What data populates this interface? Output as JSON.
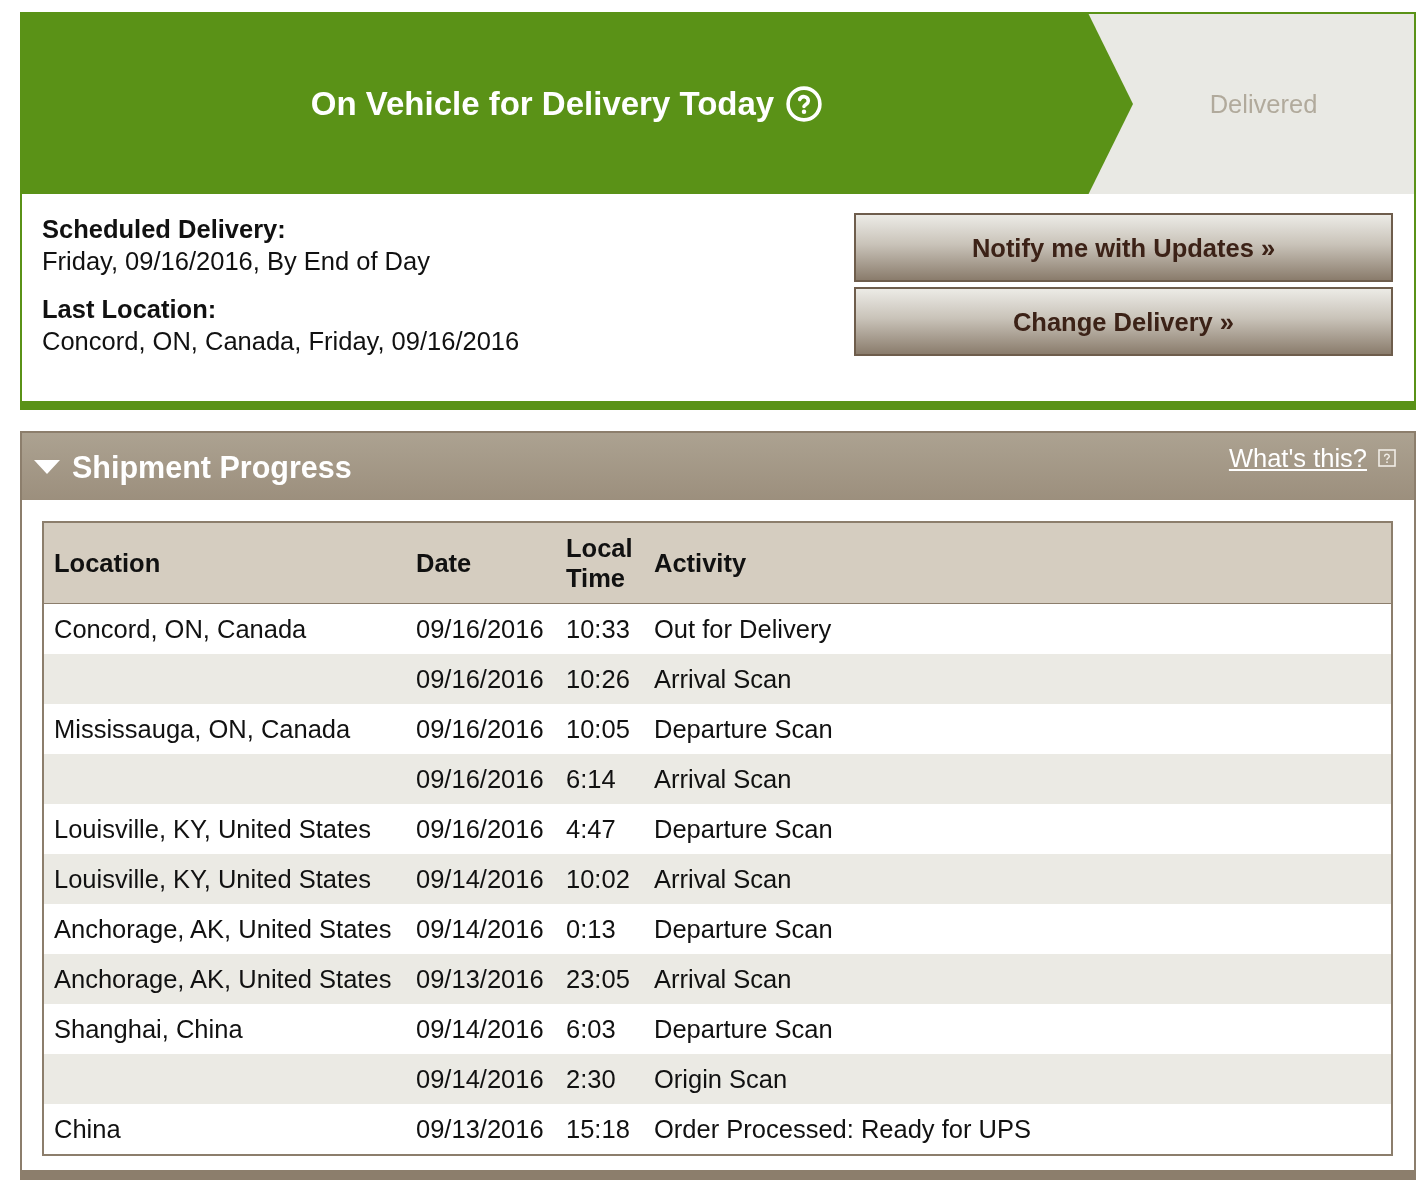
{
  "status": {
    "steps": [
      {
        "label": "On Vehicle for Delivery Today",
        "current": true,
        "help": true
      },
      {
        "label": "Delivered",
        "current": false
      }
    ]
  },
  "details": [
    {
      "label": "Scheduled Delivery:",
      "value": "Friday, 09/16/2016, By End of Day"
    },
    {
      "label": "Last Location:",
      "value": "Concord, ON, Canada, Friday, 09/16/2016"
    }
  ],
  "actions": [
    "Notify me with Updates »",
    "Change Delivery »"
  ],
  "progress": {
    "title": "Shipment Progress",
    "expanded": true,
    "help_link": "What's this?",
    "table": {
      "columns": [
        "Location",
        "Date",
        "Local Time",
        "Activity"
      ],
      "rows": [
        {
          "location": "Concord, ON, Canada",
          "date": "09/16/2016",
          "time": "10:33",
          "activity": "Out for Delivery"
        },
        {
          "date": "09/16/2016",
          "time": "10:26",
          "activity": "Arrival Scan"
        },
        {
          "location": "Mississauga, ON, Canada",
          "date": "09/16/2016",
          "time": "10:05",
          "activity": "Departure Scan"
        },
        {
          "date": "09/16/2016",
          "time": "6:14",
          "activity": "Arrival Scan"
        },
        {
          "location": "Louisville, KY, United States",
          "date": "09/16/2016",
          "time": "4:47",
          "activity": "Departure Scan"
        },
        {
          "location": "Louisville, KY, United States",
          "date": "09/14/2016",
          "time": "10:02",
          "activity": "Arrival Scan"
        },
        {
          "location": "Anchorage, AK, United States",
          "date": "09/14/2016",
          "time": "0:13",
          "activity": "Departure Scan"
        },
        {
          "location": "Anchorage, AK, United States",
          "date": "09/13/2016",
          "time": "23:05",
          "activity": "Arrival Scan"
        },
        {
          "location": "Shanghai, China",
          "date": "09/14/2016",
          "time": "6:03",
          "activity": "Departure Scan"
        },
        {
          "date": "09/14/2016",
          "time": "2:30",
          "activity": "Origin Scan"
        },
        {
          "location": "China",
          "date": "09/13/2016",
          "time": "15:18",
          "activity": "Order Processed: Ready for UPS"
        }
      ]
    }
  }
}
